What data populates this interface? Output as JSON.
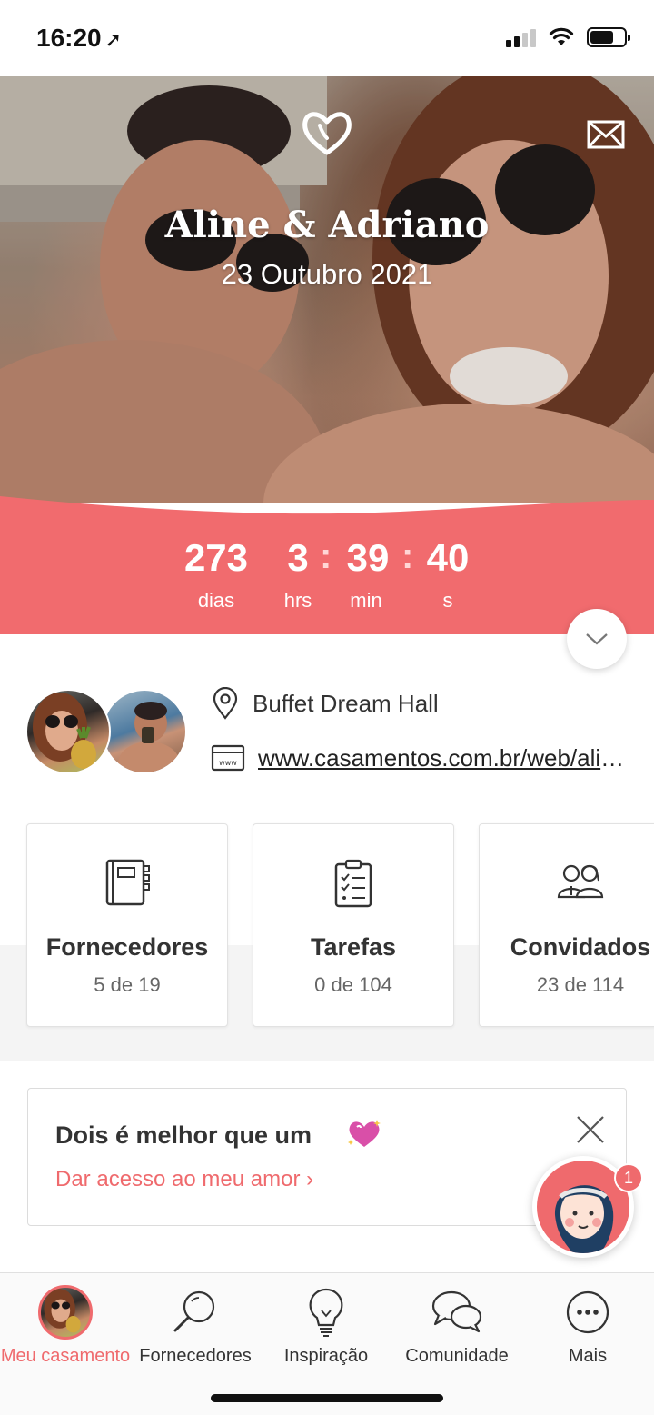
{
  "status_bar": {
    "time": "16:20"
  },
  "hero": {
    "couple_name": "Aline & Adriano",
    "wedding_date": "23 Outubro 2021"
  },
  "countdown": {
    "days": "273",
    "hours": "3",
    "minutes": "39",
    "seconds": "40",
    "separator": ":",
    "days_label": "dias",
    "hours_label": "hrs",
    "minutes_label": "min",
    "seconds_label": "s",
    "accent": "#f16b6e"
  },
  "details": {
    "venue": "Buffet Dream Hall",
    "website": "www.casamentos.com.br/web/aline-e-adriano"
  },
  "cards": [
    {
      "title": "Fornecedores",
      "subtitle": "5 de 19",
      "icon": "notebook-icon"
    },
    {
      "title": "Tarefas",
      "subtitle": "0 de 104",
      "icon": "checklist-icon"
    },
    {
      "title": "Convidados",
      "subtitle": "23 de 114",
      "icon": "guests-icon"
    }
  ],
  "promo": {
    "title": "Dois é melhor que um",
    "link": "Dar acesso ao meu amor",
    "chevron": "›"
  },
  "assistant": {
    "badge_count": "1"
  },
  "tabbar": {
    "items": [
      {
        "label": "Meu casamento",
        "icon": "profile-avatar",
        "active": true
      },
      {
        "label": "Fornecedores",
        "icon": "search-icon"
      },
      {
        "label": "Inspiração",
        "icon": "lightbulb-icon"
      },
      {
        "label": "Comunidade",
        "icon": "chat-bubbles-icon"
      },
      {
        "label": "Mais",
        "icon": "more-icon"
      }
    ]
  },
  "colors": {
    "brand": "#ef6a6d",
    "text": "#333333"
  }
}
